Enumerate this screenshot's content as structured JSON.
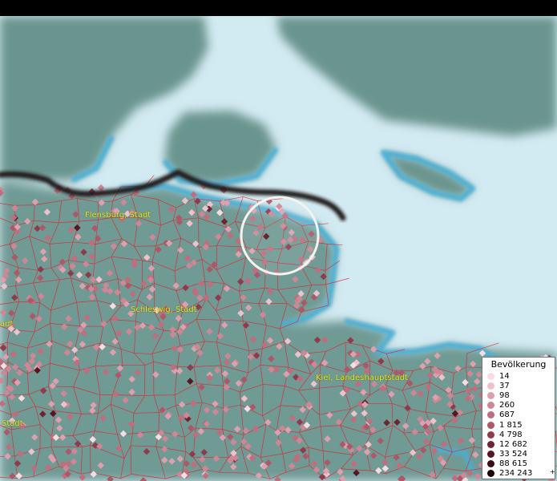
{
  "cities": [
    {
      "name": "Flensburg, Stadt"
    },
    {
      "name": "Schleswig, Stadt"
    },
    {
      "name": "Kiel, Landeshauptstadt"
    },
    {
      "name": "Stadt"
    },
    {
      "name": "adt"
    }
  ],
  "legend": {
    "title": "Bevölkerung",
    "plus": "+",
    "items": [
      {
        "label": "14",
        "color": "#f6dde3"
      },
      {
        "label": "37",
        "color": "#edc2cc"
      },
      {
        "label": "98",
        "color": "#dea0ae"
      },
      {
        "label": "260",
        "color": "#cf8796"
      },
      {
        "label": "687",
        "color": "#bf6e7e"
      },
      {
        "label": "1 815",
        "color": "#ad5868"
      },
      {
        "label": "4 798",
        "color": "#8e3c4c"
      },
      {
        "label": "12 682",
        "color": "#6f2434"
      },
      {
        "label": "33 524",
        "color": "#561623"
      },
      {
        "label": "88 615",
        "color": "#3d0c14"
      },
      {
        "label": "234 243",
        "color": "#1e0306"
      }
    ]
  },
  "colors": {
    "land": "#6f9a94",
    "water": "#d2eaf1",
    "coast": "#49aed4",
    "borders": "#e0232e",
    "national_border": "#1c1713",
    "label": "#e8e82a"
  }
}
